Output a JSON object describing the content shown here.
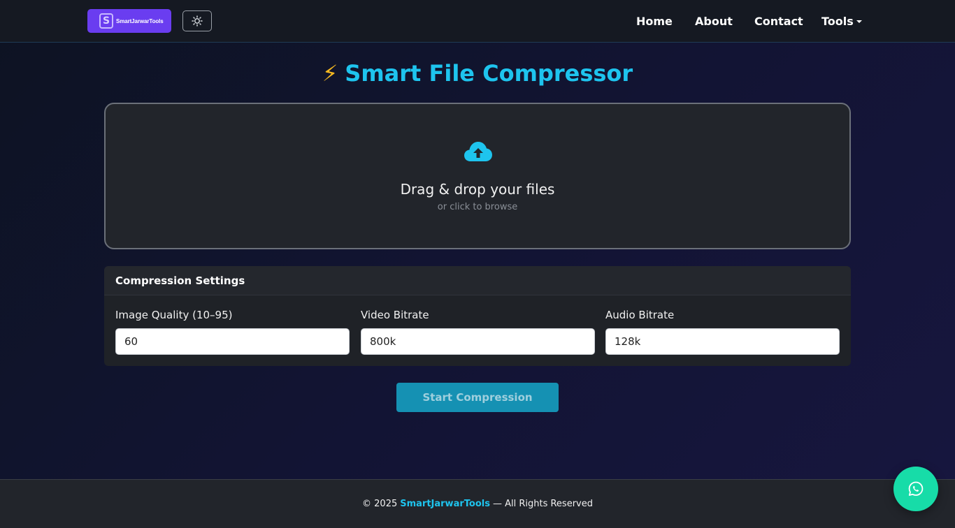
{
  "navbar": {
    "logo_text": "SmartJarwarTools",
    "logo_mark": "S",
    "theme_toggle_icon": "sun-icon",
    "links": [
      {
        "label": "Home"
      },
      {
        "label": "About"
      },
      {
        "label": "Contact"
      },
      {
        "label": "Tools"
      }
    ]
  },
  "page": {
    "title_icon": "⚡",
    "title": "Smart File Compressor"
  },
  "dropzone": {
    "icon": "cloud-upload-icon",
    "title": "Drag & drop your files",
    "subtitle": "or click to browse"
  },
  "settings": {
    "header": "Compression Settings",
    "fields": [
      {
        "label": "Image Quality (10–95)",
        "value": "60"
      },
      {
        "label": "Video Bitrate",
        "value": "800k"
      },
      {
        "label": "Audio Bitrate",
        "value": "128k"
      }
    ]
  },
  "actions": {
    "start_label": "Start Compression"
  },
  "footer": {
    "prefix": "© 2025",
    "brand": "SmartJarwarTools",
    "suffix": "— All Rights Reserved"
  },
  "whatsapp": {
    "icon": "whatsapp-icon"
  },
  "colors": {
    "accent": "#1ec4ee",
    "logo_bg": "#6a3df0",
    "button_bg": "#1591b3",
    "whatsapp_bg": "#17dca8"
  }
}
